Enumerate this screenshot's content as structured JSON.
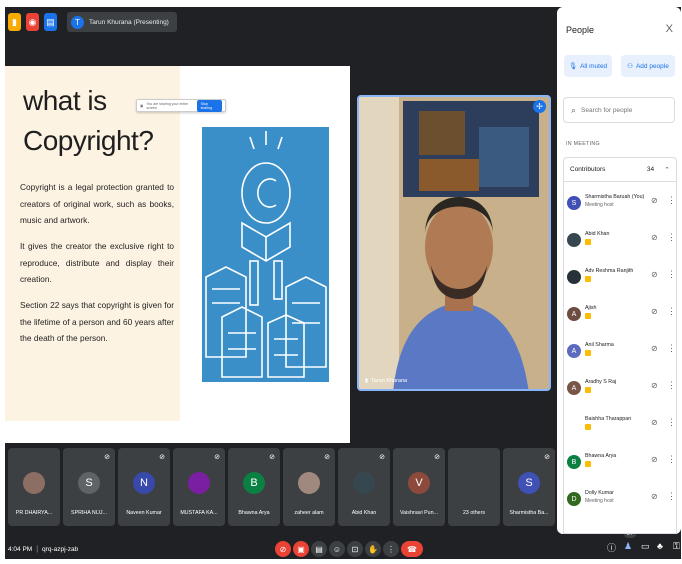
{
  "topbar": {
    "presenter_initial": "T",
    "presenter_label": "Tarun Khurana (Presenting)"
  },
  "slide": {
    "title": "what is Copyright?",
    "paragraphs": [
      "Copyright is a legal protection granted to creators of original work, such as books, music and artwork.",
      "It gives the creator the exclusive right to reproduce, distribute and display their creation.",
      "Section 22 says that copyright is given for the lifetime of a person and 60 years after the death of the person."
    ],
    "screenshare_text": "You are sharing your entire screen",
    "screenshare_stop": "Stop sharing"
  },
  "video": {
    "name": "Tarun Khurana"
  },
  "filmstrip": [
    {
      "name": "PR DHAIRYA...",
      "initial": "",
      "color": "#8d6e63"
    },
    {
      "name": "SPRIHA NIJJ...",
      "initial": "S",
      "color": "#5f6368"
    },
    {
      "name": "Naveen Kumar",
      "initial": "N",
      "color": "#3949ab"
    },
    {
      "name": "MUSTAFA KA...",
      "initial": "",
      "color": "#7b1fa2"
    },
    {
      "name": "Bhawna Arya",
      "initial": "B",
      "color": "#0b8043"
    },
    {
      "name": "zaheer alam",
      "initial": "",
      "color": "#a1887f"
    },
    {
      "name": "Abid Khan",
      "initial": "",
      "color": "#37474f"
    },
    {
      "name": "Vaishnavi Pun...",
      "initial": "V",
      "color": "#8d4a3c"
    },
    {
      "name": "23 others",
      "initial": "",
      "color": "#3c4043"
    },
    {
      "name": "Sharmistha Ba...",
      "initial": "S",
      "color": "#3f51b5"
    }
  ],
  "bottombar": {
    "time": "4:04 PM",
    "separator": "|",
    "meeting_code": "qrq-azpj-zab",
    "people_count": "34"
  },
  "panel": {
    "title": "People",
    "close": "X",
    "all_muted": "All muted",
    "add_people": "Add people",
    "search_placeholder": "Search for people",
    "in_meeting": "IN MEETING",
    "contributors_label": "Contributors",
    "contributors_count": "34",
    "people": [
      {
        "name": "Sharmistha Baruah (You)",
        "role": "Meeting host",
        "initial": "S",
        "color": "#3f51b5",
        "badge": false
      },
      {
        "name": "Abid Khan",
        "role": "",
        "initial": "",
        "color": "#37474f",
        "badge": true
      },
      {
        "name": "Adv Reshma Ranjith",
        "role": "",
        "initial": "",
        "color": "#263238",
        "badge": true
      },
      {
        "name": "Ajish",
        "role": "",
        "initial": "A",
        "color": "#6d4c41",
        "badge": true
      },
      {
        "name": "Anil Sharma",
        "role": "",
        "initial": "A",
        "color": "#5c6bc0",
        "badge": true
      },
      {
        "name": "Aradhy S Raj",
        "role": "",
        "initial": "A",
        "color": "#795548",
        "badge": true
      },
      {
        "name": "Baishha Tharappan",
        "role": "",
        "initial": "",
        "color": "#ffffff",
        "badge": true
      },
      {
        "name": "Bhawna Arya",
        "role": "",
        "initial": "B",
        "color": "#0b8043",
        "badge": true
      },
      {
        "name": "Dolly Kumar",
        "role": "Meeting host",
        "initial": "D",
        "color": "#33691e",
        "badge": false
      }
    ]
  },
  "colors": {
    "accent": "#1a73e8",
    "leave": "#ea4335",
    "background": "#202124"
  }
}
